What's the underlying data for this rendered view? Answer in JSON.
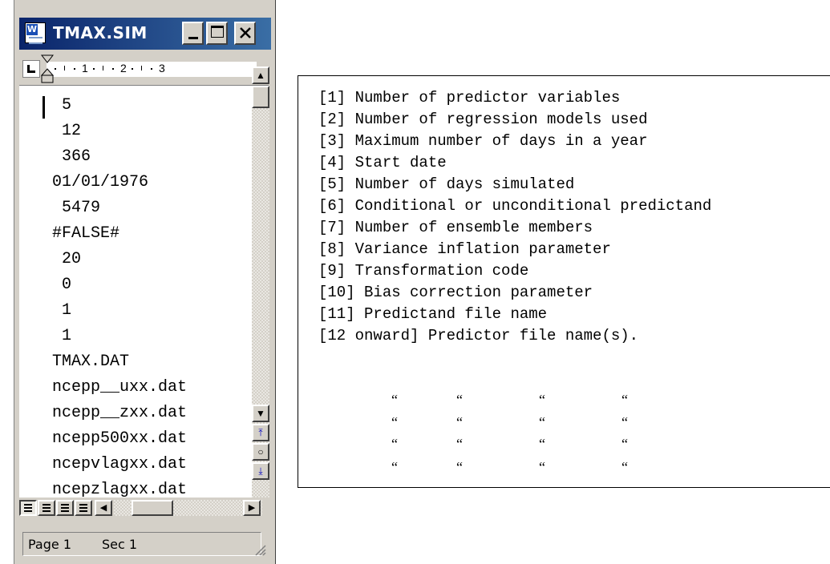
{
  "window": {
    "title": "TMAX.SIM",
    "ruler_numbers": [
      "1",
      "2",
      "3"
    ]
  },
  "document": {
    "lines": [
      " 5",
      " 12",
      " 366",
      "01/01/1976",
      " 5479",
      "#FALSE#",
      " 20",
      " 0",
      " 1",
      " 1",
      "TMAX.DAT",
      "ncepp__uxx.dat",
      "ncepp__zxx.dat",
      "ncepp500xx.dat",
      "ncepvlagxx.dat",
      "ncepzlagxx.dat"
    ]
  },
  "statusbar": {
    "page": "Page 1",
    "section": "Sec 1"
  },
  "legend": {
    "items": [
      "[1] Number of predictor variables",
      "[2] Number of regression models used",
      "[3] Maximum number of days in a year",
      "[4] Start date",
      "[5] Number of days simulated",
      "[6] Conditional or unconditional predictand",
      "[7] Number of ensemble members",
      "[8] Variance inflation parameter",
      "[9] Transformation code",
      "[10] Bias correction parameter",
      "[11] Predictand file name",
      "[12 onward] Predictor file name(s)."
    ],
    "ditto_mark": "“"
  },
  "colors": {
    "titlebar_start": "#0a246a",
    "titlebar_end": "#3a6ea5",
    "window_face": "#d4d0c8"
  },
  "icons": [
    "word-document-icon",
    "minimize-icon",
    "maximize-icon",
    "close-icon",
    "tab-selector-icon",
    "scroll-up-icon",
    "scroll-down-icon",
    "previous-page-icon",
    "select-browse-object-icon",
    "next-page-icon",
    "normal-view-icon",
    "web-layout-view-icon",
    "print-layout-view-icon",
    "outline-view-icon",
    "scroll-left-icon",
    "scroll-right-icon",
    "size-grip-icon"
  ]
}
